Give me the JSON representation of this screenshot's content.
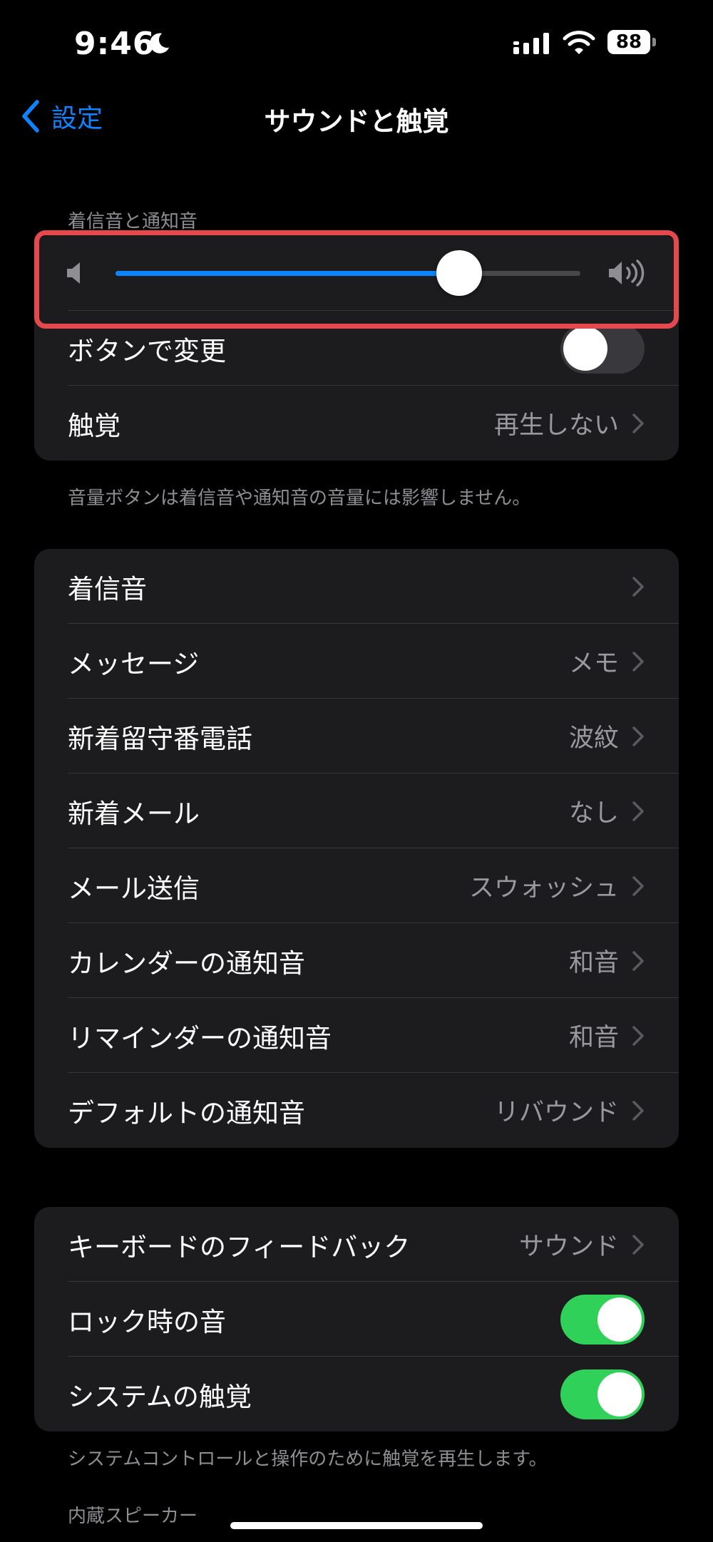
{
  "status": {
    "time": "9:46",
    "battery": "88"
  },
  "nav": {
    "back_label": "設定",
    "title": "サウンドと触覚"
  },
  "ringer": {
    "header": "着信音と通知音",
    "volume_level": 0.74,
    "rows": [
      {
        "label": "ボタンで変更",
        "toggle": false
      },
      {
        "label": "触覚",
        "value": "再生しない"
      }
    ],
    "footer": "音量ボタンは着信音や通知音の音量には影響しません。"
  },
  "sounds": {
    "rows": [
      {
        "label": "着信音",
        "value": ""
      },
      {
        "label": "メッセージ",
        "value": "メモ"
      },
      {
        "label": "新着留守番電話",
        "value": "波紋"
      },
      {
        "label": "新着メール",
        "value": "なし"
      },
      {
        "label": "メール送信",
        "value": "スウォッシュ"
      },
      {
        "label": "カレンダーの通知音",
        "value": "和音"
      },
      {
        "label": "リマインダーの通知音",
        "value": "和音"
      },
      {
        "label": "デフォルトの通知音",
        "value": "リバウンド"
      }
    ]
  },
  "feedback": {
    "rows": [
      {
        "label": "キーボードのフィードバック",
        "value": "サウンド"
      },
      {
        "label": "ロック時の音",
        "toggle": true
      },
      {
        "label": "システムの触覚",
        "toggle": true
      }
    ],
    "footer": "システムコントロールと操作のために触覚を再生します。"
  },
  "speaker": {
    "header": "内蔵スピーカー"
  },
  "colors": {
    "accent": "#0a84ff",
    "toggle_on": "#30d158",
    "highlight": "#e5484d"
  }
}
